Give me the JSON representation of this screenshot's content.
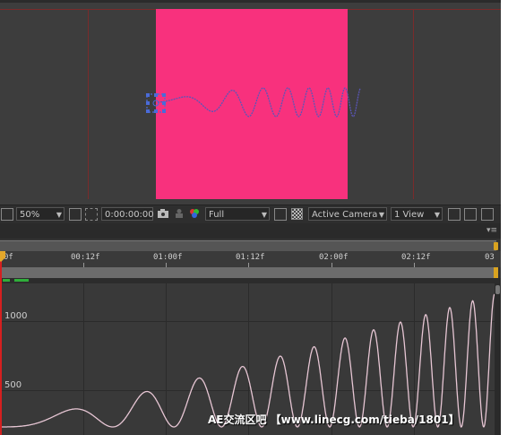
{
  "toolbar": {
    "magnification": "50%",
    "timecode": "0:00:00:00",
    "resolution": "Full",
    "view": "Active Camera",
    "layout": "1 View"
  },
  "ruler": {
    "labels": [
      "0f",
      "00:12f",
      "01:00f",
      "01:12f",
      "02:00f",
      "02:12f",
      "03"
    ]
  },
  "graph": {
    "y_labels": [
      "1000",
      "500"
    ],
    "curve_color": "#e7c6d4"
  },
  "comp": {
    "background_color": "#f8317d"
  },
  "watermark": "AE交流区吧 【www.linecg.com/tieba/1801】"
}
